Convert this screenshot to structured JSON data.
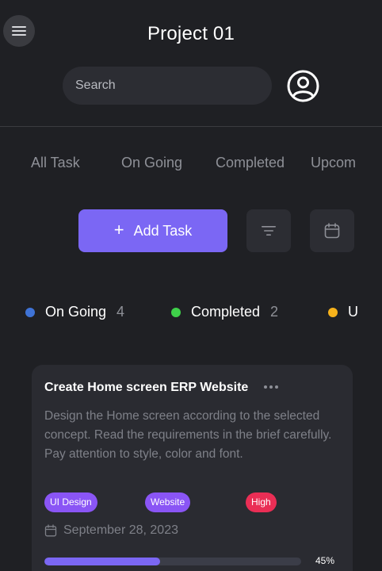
{
  "header": {
    "title": "Project 01",
    "search_placeholder": "Search"
  },
  "tabs": [
    {
      "label": "All Task"
    },
    {
      "label": "On Going"
    },
    {
      "label": "Completed"
    },
    {
      "label": "Upcom"
    }
  ],
  "actions": {
    "add_task_label": "Add Task"
  },
  "status_legend": [
    {
      "label": "On Going",
      "count": "4",
      "color": "#3f73d6"
    },
    {
      "label": "Completed",
      "count": "2",
      "color": "#3fd14a"
    },
    {
      "label": "U",
      "count": "",
      "color": "#f6b21b"
    }
  ],
  "task_card": {
    "title": "Create Home screen ERP Website",
    "description": "Design the Home screen according to the selected concept. Read the requirements in the brief carefully. Pay attention to style, color and font.",
    "tags": [
      {
        "label": "UI Design",
        "color": "#8a55f5"
      },
      {
        "label": "Website",
        "color": "#8a55f5"
      },
      {
        "label": "High",
        "color": "#ea2e55"
      }
    ],
    "date": "September 28, 2023",
    "progress": 45,
    "progress_label": "45%"
  },
  "colors": {
    "background": "#1f2024",
    "accent": "#7b67f4",
    "surface": "#2a2b31"
  }
}
